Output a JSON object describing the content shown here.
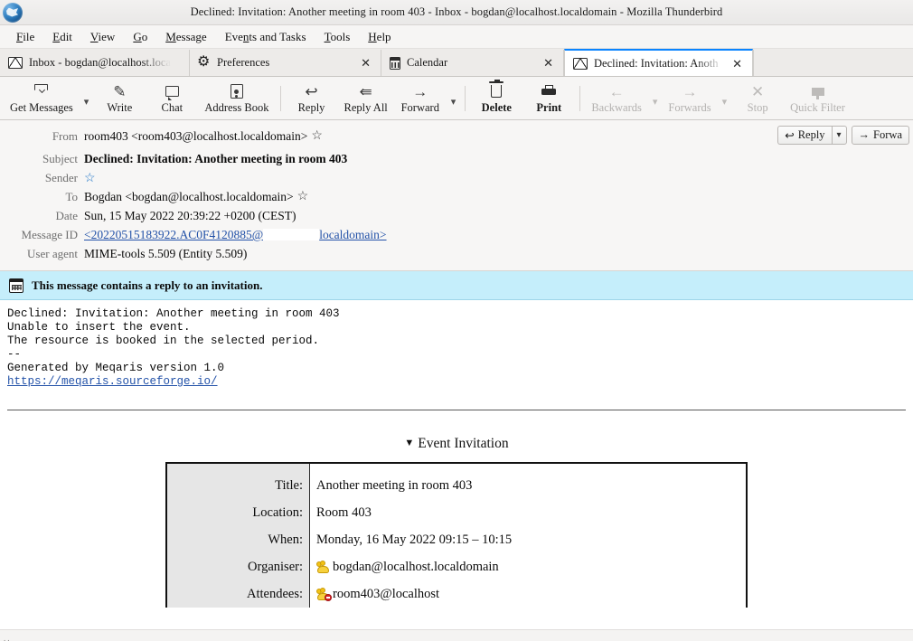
{
  "window": {
    "title": "Declined: Invitation: Another meeting in room 403 - Inbox - bogdan@localhost.localdomain - Mozilla Thunderbird",
    "logo_icon": "thunderbird-logo"
  },
  "menubar": {
    "items": [
      {
        "label": "File",
        "accesskey": "F"
      },
      {
        "label": "Edit",
        "accesskey": "E"
      },
      {
        "label": "View",
        "accesskey": "V"
      },
      {
        "label": "Go",
        "accesskey": "G"
      },
      {
        "label": "Message",
        "accesskey": "M"
      },
      {
        "label": "Events and Tasks",
        "accesskey": "n"
      },
      {
        "label": "Tools",
        "accesskey": "T"
      },
      {
        "label": "Help",
        "accesskey": "H"
      }
    ]
  },
  "tabs": [
    {
      "label": "Inbox - bogdan@localhost.loca",
      "icon": "envelope-icon",
      "active": false,
      "closable": false
    },
    {
      "label": "Preferences",
      "icon": "gear-icon",
      "active": false,
      "closable": true
    },
    {
      "label": "Calendar",
      "icon": "calendar-icon",
      "active": false,
      "closable": true
    },
    {
      "label": "Declined: Invitation: Anoth",
      "icon": "envelope-icon",
      "active": true,
      "closable": true
    }
  ],
  "toolbar": {
    "buttons": [
      {
        "label": "Get Messages",
        "icon": "get-messages-icon",
        "disabled": false,
        "dropdown": true
      },
      {
        "label": "Write",
        "icon": "pencil-icon",
        "disabled": false,
        "dropdown": false
      },
      {
        "label": "Chat",
        "icon": "chat-bubble-icon",
        "disabled": false,
        "dropdown": false
      },
      {
        "label": "Address Book",
        "icon": "address-book-icon",
        "disabled": false,
        "dropdown": false
      },
      {
        "label": "Reply",
        "icon": "reply-arrow-icon",
        "disabled": false,
        "dropdown": false
      },
      {
        "label": "Reply All",
        "icon": "reply-all-arrow-icon",
        "disabled": false,
        "dropdown": false
      },
      {
        "label": "Forward",
        "icon": "forward-arrow-icon",
        "disabled": false,
        "dropdown": true
      },
      {
        "label": "Delete",
        "icon": "trash-icon",
        "disabled": false,
        "dropdown": false
      },
      {
        "label": "Print",
        "icon": "printer-icon",
        "disabled": false,
        "dropdown": false
      },
      {
        "label": "Backwards",
        "icon": "arrow-left-icon",
        "disabled": true,
        "dropdown": true
      },
      {
        "label": "Forwards",
        "icon": "arrow-right-icon",
        "disabled": true,
        "dropdown": true
      },
      {
        "label": "Stop",
        "icon": "close-x-icon",
        "disabled": true,
        "dropdown": false
      },
      {
        "label": "Quick Filter",
        "icon": "funnel-icon",
        "disabled": true,
        "dropdown": false
      }
    ]
  },
  "message_header": {
    "from_label": "From",
    "from_value": "room403 <room403@localhost.localdomain>",
    "subject_label": "Subject",
    "subject_value": "Declined: Invitation: Another meeting in room 403",
    "sender_label": "Sender",
    "sender_value": "",
    "to_label": "To",
    "to_value": "Bogdan <bogdan@localhost.localdomain>",
    "date_label": "Date",
    "date_value": "Sun, 15 May 2022 20:39:22 +0200 (CEST)",
    "messageid_label": "Message ID",
    "messageid_prefix": "<20220515183922.AC0F4120885@",
    "messageid_suffix": "localdomain>",
    "useragent_label": "User agent",
    "useragent_value": "MIME-tools 5.509 (Entity 5.509)",
    "reply_button": "Reply",
    "forward_button": "Forwa",
    "star_icon": "star-icon"
  },
  "notification": {
    "icon": "calendar-icon",
    "text": "This message contains a reply to an invitation."
  },
  "body": {
    "lines": [
      "Declined: Invitation: Another meeting in room 403",
      "Unable to insert the event.",
      "The resource is booked in the selected period."
    ],
    "signature_sep": "--",
    "generated_by": "Generated by Meqaris version 1.0",
    "link": "https://meqaris.sourceforge.io/"
  },
  "invitation": {
    "heading": "Event Invitation",
    "collapse_icon": "triangle-down-icon",
    "rows": [
      {
        "label": "Title:",
        "value": "Another meeting in room 403",
        "icon": null
      },
      {
        "label": "Location:",
        "value": "Room 403",
        "icon": null
      },
      {
        "label": "When:",
        "value": "Monday, 16 May 2022 09:15 – 10:15",
        "icon": null
      },
      {
        "label": "Organiser:",
        "value": "bogdan@localhost.localdomain",
        "icon": "person-icon"
      },
      {
        "label": "Attendees:",
        "value": "room403@localhost",
        "icon": "person-declined-icon"
      }
    ]
  },
  "colors": {
    "accent": "#0a84ff",
    "notification_bg": "#c5eefb",
    "link": "#2352a8",
    "star_active": "#1a73c7",
    "declined_badge": "#d8272a"
  }
}
